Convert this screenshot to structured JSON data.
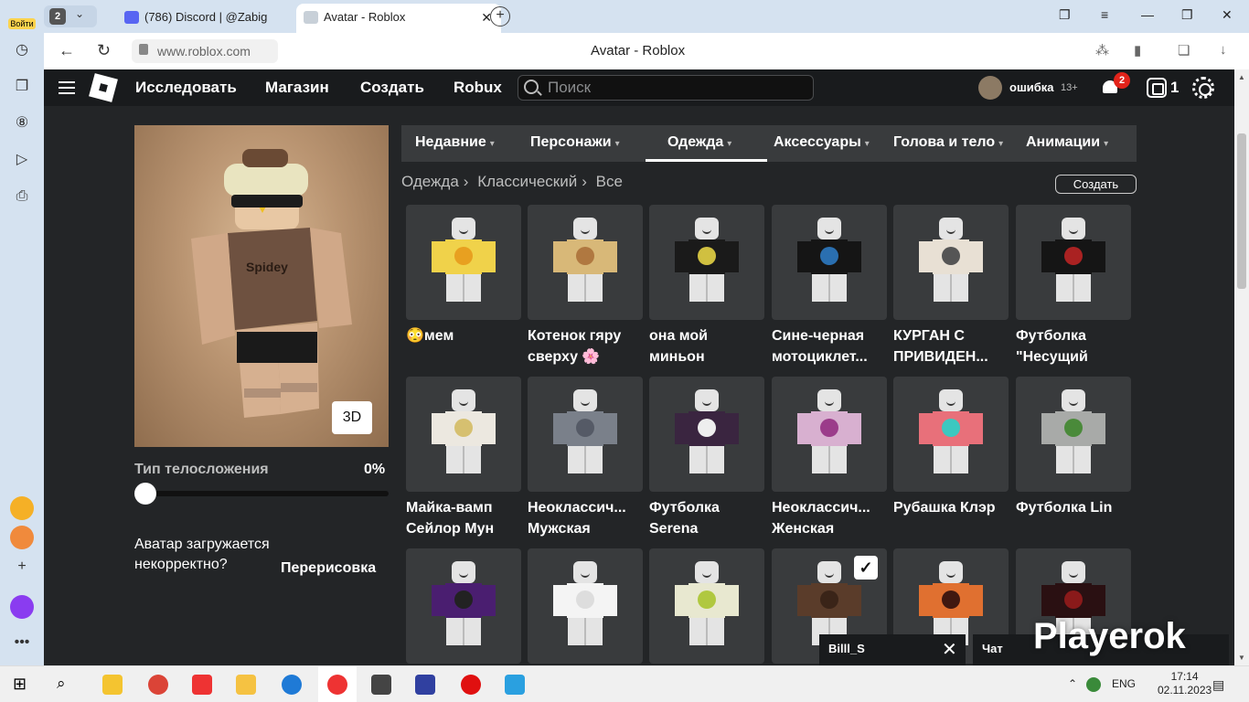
{
  "browser": {
    "sidebar_login": "Войти",
    "tab_count": "2",
    "tabs": [
      {
        "title": "(786) Discord | @Zabig"
      },
      {
        "title": "Avatar - Roblox"
      }
    ],
    "url": "www.roblox.com",
    "page_title": "Avatar - Roblox",
    "downloads_badge": "2"
  },
  "header": {
    "nav": [
      "Исследовать",
      "Магазин",
      "Создать",
      "Robux"
    ],
    "search_placeholder": "Поиск",
    "username": "ошибка",
    "age": "13+",
    "notifications": "2",
    "robux": "1"
  },
  "left": {
    "btn_3d": "3D",
    "body_type_label": "Тип телосложения",
    "body_type_value": "0%",
    "body_type_fraction": 0,
    "avatar_msg": "Аватар загружается некорректно?",
    "redraw": "Перерисовка"
  },
  "category_tabs": [
    "Недавние",
    "Персонажи",
    "Одежда",
    "Аксессуары",
    "Голова и тело",
    "Анимации"
  ],
  "active_tab": "Одежда",
  "breadcrumb": [
    "Одежда",
    "Классический",
    "Все"
  ],
  "create_button": "Создать",
  "items": [
    {
      "name": "😳мем",
      "color": "#f0d24a",
      "accent": "#e8a020"
    },
    {
      "name": "Котенок гяру сверху 🌸",
      "color": "#d8b878",
      "accent": "#b07840"
    },
    {
      "name": "она мой миньон",
      "color": "#1a1a1a",
      "accent": "#d0c040"
    },
    {
      "name": "Сине-черная мотоциклет...",
      "color": "#151515",
      "accent": "#2a6fb0"
    },
    {
      "name": "КУРГАН С ПРИВИДЕН...",
      "color": "#e8e0d4",
      "accent": "#555555"
    },
    {
      "name": "Футболка \"Несущий",
      "color": "#151515",
      "accent": "#aa2222"
    },
    {
      "name": "Майка-вамп Сейлор Мун",
      "color": "#ece8e0",
      "accent": "#d6c070"
    },
    {
      "name": "Неоклассич... Мужская",
      "color": "#7a808a",
      "accent": "#555a66"
    },
    {
      "name": "Футболка Serena",
      "color": "#3a2540",
      "accent": "#eeeeee"
    },
    {
      "name": "Неоклассич... Женская",
      "color": "#d8b0d0",
      "accent": "#9b3c8a"
    },
    {
      "name": "Рубашка Клэр",
      "color": "#e8707a",
      "accent": "#3cc8c0"
    },
    {
      "name": "Футболка Lin",
      "color": "#a8aaa8",
      "accent": "#4a8a3a"
    },
    {
      "name": "",
      "color": "#4a1e70",
      "accent": "#222222"
    },
    {
      "name": "",
      "color": "#f4f4f4",
      "accent": "#dddddd"
    },
    {
      "name": "",
      "color": "#e8e8d0",
      "accent": "#b0c840"
    },
    {
      "name": "",
      "color": "#5a3c2a",
      "accent": "#3a2418",
      "checked": true
    },
    {
      "name": "",
      "color": "#e07030",
      "accent": "#401810"
    },
    {
      "name": "",
      "color": "#2a1012",
      "accent": "#8a1a1a"
    }
  ],
  "chat": {
    "contact": "Billl_S",
    "label": "Чат"
  },
  "watermark": "Playerok",
  "taskbar": {
    "lang": "ENG",
    "time": "17:14",
    "date": "02.11.2023"
  }
}
